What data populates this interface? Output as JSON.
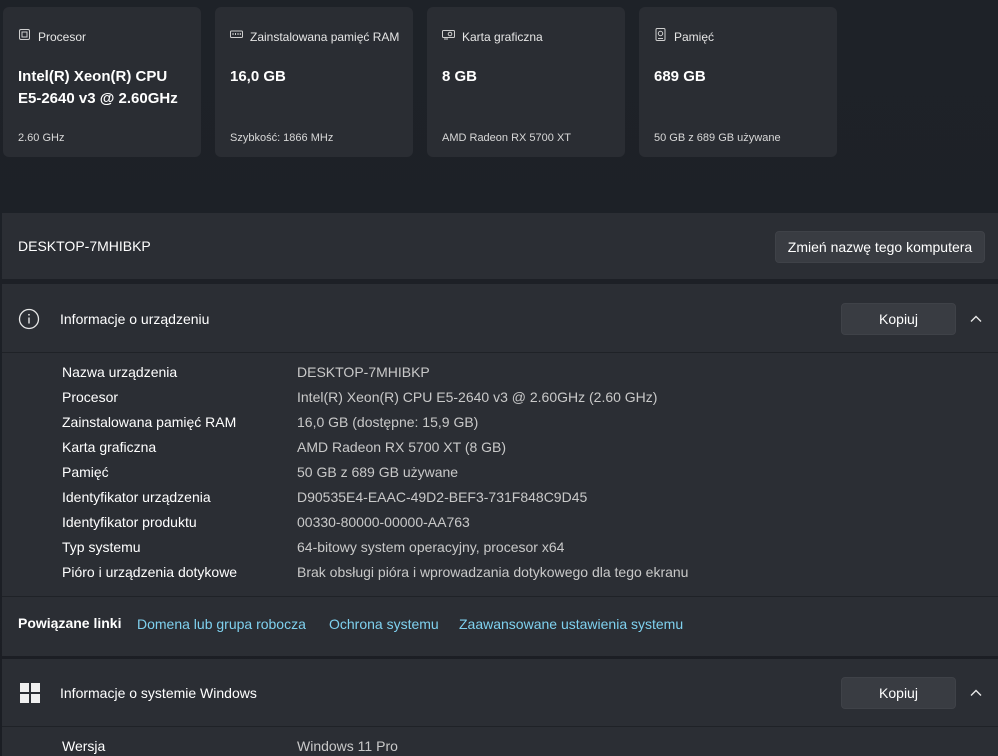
{
  "specs": [
    {
      "icon": "cpu-icon",
      "title": "Procesor",
      "value": "Intel(R) Xeon(R) CPU E5-2640 v3 @ 2.60GHz",
      "sub": "2.60 GHz"
    },
    {
      "icon": "ram-icon",
      "title": "Zainstalowana pamięć RAM",
      "value": "16,0 GB",
      "sub": "Szybkość: 1866 MHz"
    },
    {
      "icon": "gpu-icon",
      "title": "Karta graficzna",
      "value": "8 GB",
      "sub": "AMD Radeon RX 5700 XT"
    },
    {
      "icon": "storage-icon",
      "title": "Pamięć",
      "value": "689 GB",
      "sub": "50 GB z 689 GB używane"
    }
  ],
  "computer": {
    "name": "DESKTOP-7MHIBKP",
    "rename_label": "Zmień nazwę tego komputera"
  },
  "device_info": {
    "title": "Informacje o urządzeniu",
    "copy_label": "Kopiuj",
    "rows": [
      {
        "label": "Nazwa urządzenia",
        "value": "DESKTOP-7MHIBKP"
      },
      {
        "label": "Procesor",
        "value": "Intel(R) Xeon(R) CPU E5-2640 v3 @ 2.60GHz (2.60 GHz)"
      },
      {
        "label": "Zainstalowana pamięć RAM",
        "value": "16,0 GB (dostępne: 15,9 GB)"
      },
      {
        "label": "Karta graficzna",
        "value": "AMD Radeon RX 5700 XT (8 GB)"
      },
      {
        "label": "Pamięć",
        "value": "50 GB z 689 GB używane"
      },
      {
        "label": "Identyfikator urządzenia",
        "value": "D90535E4-EAAC-49D2-BEF3-731F848C9D45"
      },
      {
        "label": "Identyfikator produktu",
        "value": "00330-80000-00000-AA763"
      },
      {
        "label": "Typ systemu",
        "value": "64-bitowy system operacyjny, procesor x64"
      },
      {
        "label": "Pióro i urządzenia dotykowe",
        "value": "Brak obsługi pióra i wprowadzania dotykowego dla tego ekranu"
      }
    ]
  },
  "related_links": {
    "label": "Powiązane linki",
    "links": [
      "Domena lub grupa robocza",
      "Ochrona systemu",
      "Zaawansowane ustawienia systemu"
    ]
  },
  "windows_info": {
    "title": "Informacje o systemie Windows",
    "copy_label": "Kopiuj",
    "rows": [
      {
        "label": "Wersja",
        "value": "Windows 11 Pro"
      }
    ]
  },
  "colors": {
    "link": "#7fd1ef",
    "panel": "#2b2e34",
    "background": "#1c2026"
  }
}
